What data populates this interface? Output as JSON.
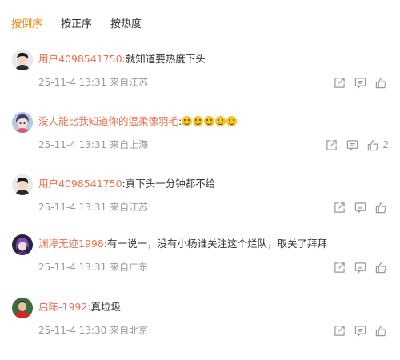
{
  "sort_tabs": [
    {
      "label": "按倒序",
      "active": true
    },
    {
      "label": "按正序",
      "active": false
    },
    {
      "label": "按热度",
      "active": false
    }
  ],
  "accent_color": "#ff8200",
  "username_color": "#eb7350",
  "comments": [
    {
      "user": "用户4098541750",
      "text": ":就知道要热度下头",
      "time": "25-11-4 13:31",
      "location": "来自江苏",
      "likes": "",
      "avatar": "person-dark-hair-icon",
      "emoji_count": 0
    },
    {
      "user": "没人能比我知道你的温柔像羽毛",
      "text": ":",
      "time": "25-11-4 13:31",
      "location": "来自上海",
      "likes": "2",
      "avatar": "anime-character-icon",
      "emoji_count": 5
    },
    {
      "user": "用户4098541750",
      "text": ":真下头一分钟都不给",
      "time": "25-11-4 13:31",
      "location": "来自江苏",
      "likes": "",
      "avatar": "person-dark-hair-icon",
      "emoji_count": 0
    },
    {
      "user": "渊渟无迹1998",
      "text": ":有一说一，没有小杨谁关注这个烂队，取关了拜拜",
      "time": "25-11-4 13:31",
      "location": "来自广东",
      "likes": "",
      "avatar": "purple-hair-character-icon",
      "emoji_count": 0
    },
    {
      "user": "启陈-1992",
      "text": ":真垃圾",
      "time": "25-11-4 13:30",
      "location": "来自北京",
      "likes": "",
      "avatar": "red-jersey-player-icon",
      "emoji_count": 0
    }
  ]
}
